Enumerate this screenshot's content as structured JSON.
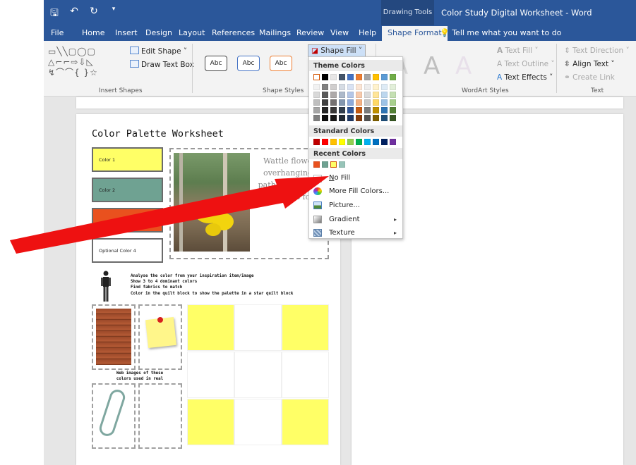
{
  "window": {
    "title": "Color Study Digital Worksheet  -  Word",
    "context_tab_group": "Drawing Tools"
  },
  "tabs": [
    "File",
    "Home",
    "Insert",
    "Design",
    "Layout",
    "References",
    "Mailings",
    "Review",
    "View",
    "Help",
    "Shape Format"
  ],
  "active_tab": "Shape Format",
  "tell_me": "Tell me what you want to do",
  "ribbon": {
    "insert_shapes": {
      "label": "Insert Shapes",
      "edit_shape": "Edit Shape ˅",
      "draw_text_box": "Draw Text Box"
    },
    "shape_styles": {
      "label": "Shape Styles",
      "style_labels": [
        "Abc",
        "Abc",
        "Abc"
      ],
      "shape_fill": "Shape Fill ˅"
    },
    "wordart_styles": {
      "label": "WordArt Styles",
      "text_fill": "Text Fill ˅",
      "text_outline": "Text Outline ˅",
      "text_effects": "Text Effects ˅"
    },
    "text": {
      "label": "Text",
      "text_direction": "Text Direction ˅",
      "align_text": "Align Text ˅",
      "create_link": "Create Link"
    }
  },
  "shape_fill_menu": {
    "theme_colors_header": "Theme Colors",
    "theme_colors_top": [
      "#ffffff",
      "#000000",
      "#e7e6e6",
      "#44546a",
      "#4472c4",
      "#ed7d31",
      "#a5a5a5",
      "#ffc000",
      "#5b9bd5",
      "#70ad47"
    ],
    "theme_shade_columns": [
      [
        "#f2f2f2",
        "#d9d9d9",
        "#bfbfbf",
        "#a6a6a6",
        "#808080"
      ],
      [
        "#808080",
        "#595959",
        "#404040",
        "#262626",
        "#0d0d0d"
      ],
      [
        "#d0cece",
        "#aeaaaa",
        "#757171",
        "#3a3838",
        "#171616"
      ],
      [
        "#d6dce4",
        "#adb9ca",
        "#8497b0",
        "#333f4f",
        "#222a35"
      ],
      [
        "#d9e2f3",
        "#b4c6e7",
        "#8eaadb",
        "#2f5496",
        "#1f3864"
      ],
      [
        "#fbe5d5",
        "#f7caac",
        "#f4b183",
        "#c55a11",
        "#843c0c"
      ],
      [
        "#ededed",
        "#dbdbdb",
        "#c9c9c9",
        "#7b7b7b",
        "#525252"
      ],
      [
        "#fff2cc",
        "#ffe598",
        "#ffd966",
        "#bf9000",
        "#7f6000"
      ],
      [
        "#deebf6",
        "#bdd7ee",
        "#9dc3e6",
        "#2e75b5",
        "#1e4e79"
      ],
      [
        "#e2efd9",
        "#c5e0b3",
        "#a8d08d",
        "#538135",
        "#375623"
      ]
    ],
    "standard_colors_header": "Standard Colors",
    "standard_colors": [
      "#c00000",
      "#ff0000",
      "#ffc000",
      "#ffff00",
      "#92d050",
      "#00b050",
      "#00b0f0",
      "#0070c0",
      "#002060",
      "#7030a0"
    ],
    "recent_colors_header": "Recent Colors",
    "recent_colors": [
      "#e9511e",
      "#6fa292",
      "#ffff66",
      "#97c4b8"
    ],
    "items": [
      {
        "label": "No Fill",
        "icon": "no-fill-icon"
      },
      {
        "label": "More Fill Colors...",
        "icon": "palette-icon"
      },
      {
        "label": "Picture...",
        "icon": "picture-icon"
      },
      {
        "label": "Gradient",
        "icon": "gradient-icon",
        "submenu": true
      },
      {
        "label": "Texture",
        "icon": "texture-icon",
        "submenu": true
      }
    ]
  },
  "worksheet": {
    "title": "Color Palette Worksheet",
    "color_boxes": [
      {
        "label": "Color 1",
        "fill": "#ffff66"
      },
      {
        "label": "Color 2",
        "fill": "#6fa292"
      },
      {
        "label": "",
        "fill": "#e9511e"
      },
      {
        "label": "Optional Color 4",
        "fill": "#ffffff"
      }
    ],
    "inspiration_text": "Wattle flowers overhanging a path through the eucalyptus forest",
    "instructions": [
      "Analyse the color from your inspiration item/image",
      "Show 3 to 4 dominant colors",
      "Find fabrics to match",
      "Color in the quilt block to show the palette in a star quilt block"
    ],
    "web_images_label": "Web images of these colors used in real",
    "quilt_cells": [
      "#ffff66",
      "#ffffff",
      "#ffff66",
      "#ffffff",
      "#ffffff",
      "#ffffff",
      "#ffff66",
      "#ffffff",
      "#ffff66"
    ]
  },
  "annotation": {
    "arrow_color": "#ee1111"
  }
}
